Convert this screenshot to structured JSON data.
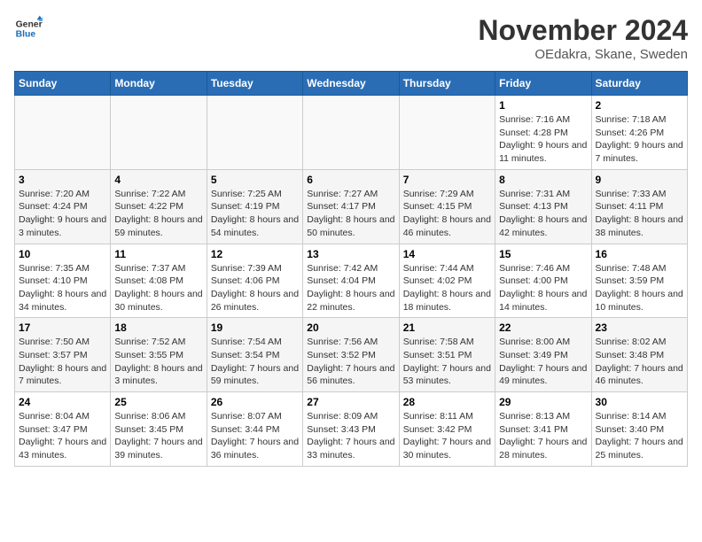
{
  "logo": {
    "line1": "General",
    "line2": "Blue"
  },
  "title": "November 2024",
  "subtitle": "OEdakra, Skane, Sweden",
  "days_of_week": [
    "Sunday",
    "Monday",
    "Tuesday",
    "Wednesday",
    "Thursday",
    "Friday",
    "Saturday"
  ],
  "weeks": [
    [
      {
        "day": "",
        "info": ""
      },
      {
        "day": "",
        "info": ""
      },
      {
        "day": "",
        "info": ""
      },
      {
        "day": "",
        "info": ""
      },
      {
        "day": "",
        "info": ""
      },
      {
        "day": "1",
        "info": "Sunrise: 7:16 AM\nSunset: 4:28 PM\nDaylight: 9 hours and 11 minutes."
      },
      {
        "day": "2",
        "info": "Sunrise: 7:18 AM\nSunset: 4:26 PM\nDaylight: 9 hours and 7 minutes."
      }
    ],
    [
      {
        "day": "3",
        "info": "Sunrise: 7:20 AM\nSunset: 4:24 PM\nDaylight: 9 hours and 3 minutes."
      },
      {
        "day": "4",
        "info": "Sunrise: 7:22 AM\nSunset: 4:22 PM\nDaylight: 8 hours and 59 minutes."
      },
      {
        "day": "5",
        "info": "Sunrise: 7:25 AM\nSunset: 4:19 PM\nDaylight: 8 hours and 54 minutes."
      },
      {
        "day": "6",
        "info": "Sunrise: 7:27 AM\nSunset: 4:17 PM\nDaylight: 8 hours and 50 minutes."
      },
      {
        "day": "7",
        "info": "Sunrise: 7:29 AM\nSunset: 4:15 PM\nDaylight: 8 hours and 46 minutes."
      },
      {
        "day": "8",
        "info": "Sunrise: 7:31 AM\nSunset: 4:13 PM\nDaylight: 8 hours and 42 minutes."
      },
      {
        "day": "9",
        "info": "Sunrise: 7:33 AM\nSunset: 4:11 PM\nDaylight: 8 hours and 38 minutes."
      }
    ],
    [
      {
        "day": "10",
        "info": "Sunrise: 7:35 AM\nSunset: 4:10 PM\nDaylight: 8 hours and 34 minutes."
      },
      {
        "day": "11",
        "info": "Sunrise: 7:37 AM\nSunset: 4:08 PM\nDaylight: 8 hours and 30 minutes."
      },
      {
        "day": "12",
        "info": "Sunrise: 7:39 AM\nSunset: 4:06 PM\nDaylight: 8 hours and 26 minutes."
      },
      {
        "day": "13",
        "info": "Sunrise: 7:42 AM\nSunset: 4:04 PM\nDaylight: 8 hours and 22 minutes."
      },
      {
        "day": "14",
        "info": "Sunrise: 7:44 AM\nSunset: 4:02 PM\nDaylight: 8 hours and 18 minutes."
      },
      {
        "day": "15",
        "info": "Sunrise: 7:46 AM\nSunset: 4:00 PM\nDaylight: 8 hours and 14 minutes."
      },
      {
        "day": "16",
        "info": "Sunrise: 7:48 AM\nSunset: 3:59 PM\nDaylight: 8 hours and 10 minutes."
      }
    ],
    [
      {
        "day": "17",
        "info": "Sunrise: 7:50 AM\nSunset: 3:57 PM\nDaylight: 8 hours and 7 minutes."
      },
      {
        "day": "18",
        "info": "Sunrise: 7:52 AM\nSunset: 3:55 PM\nDaylight: 8 hours and 3 minutes."
      },
      {
        "day": "19",
        "info": "Sunrise: 7:54 AM\nSunset: 3:54 PM\nDaylight: 7 hours and 59 minutes."
      },
      {
        "day": "20",
        "info": "Sunrise: 7:56 AM\nSunset: 3:52 PM\nDaylight: 7 hours and 56 minutes."
      },
      {
        "day": "21",
        "info": "Sunrise: 7:58 AM\nSunset: 3:51 PM\nDaylight: 7 hours and 53 minutes."
      },
      {
        "day": "22",
        "info": "Sunrise: 8:00 AM\nSunset: 3:49 PM\nDaylight: 7 hours and 49 minutes."
      },
      {
        "day": "23",
        "info": "Sunrise: 8:02 AM\nSunset: 3:48 PM\nDaylight: 7 hours and 46 minutes."
      }
    ],
    [
      {
        "day": "24",
        "info": "Sunrise: 8:04 AM\nSunset: 3:47 PM\nDaylight: 7 hours and 43 minutes."
      },
      {
        "day": "25",
        "info": "Sunrise: 8:06 AM\nSunset: 3:45 PM\nDaylight: 7 hours and 39 minutes."
      },
      {
        "day": "26",
        "info": "Sunrise: 8:07 AM\nSunset: 3:44 PM\nDaylight: 7 hours and 36 minutes."
      },
      {
        "day": "27",
        "info": "Sunrise: 8:09 AM\nSunset: 3:43 PM\nDaylight: 7 hours and 33 minutes."
      },
      {
        "day": "28",
        "info": "Sunrise: 8:11 AM\nSunset: 3:42 PM\nDaylight: 7 hours and 30 minutes."
      },
      {
        "day": "29",
        "info": "Sunrise: 8:13 AM\nSunset: 3:41 PM\nDaylight: 7 hours and 28 minutes."
      },
      {
        "day": "30",
        "info": "Sunrise: 8:14 AM\nSunset: 3:40 PM\nDaylight: 7 hours and 25 minutes."
      }
    ]
  ]
}
